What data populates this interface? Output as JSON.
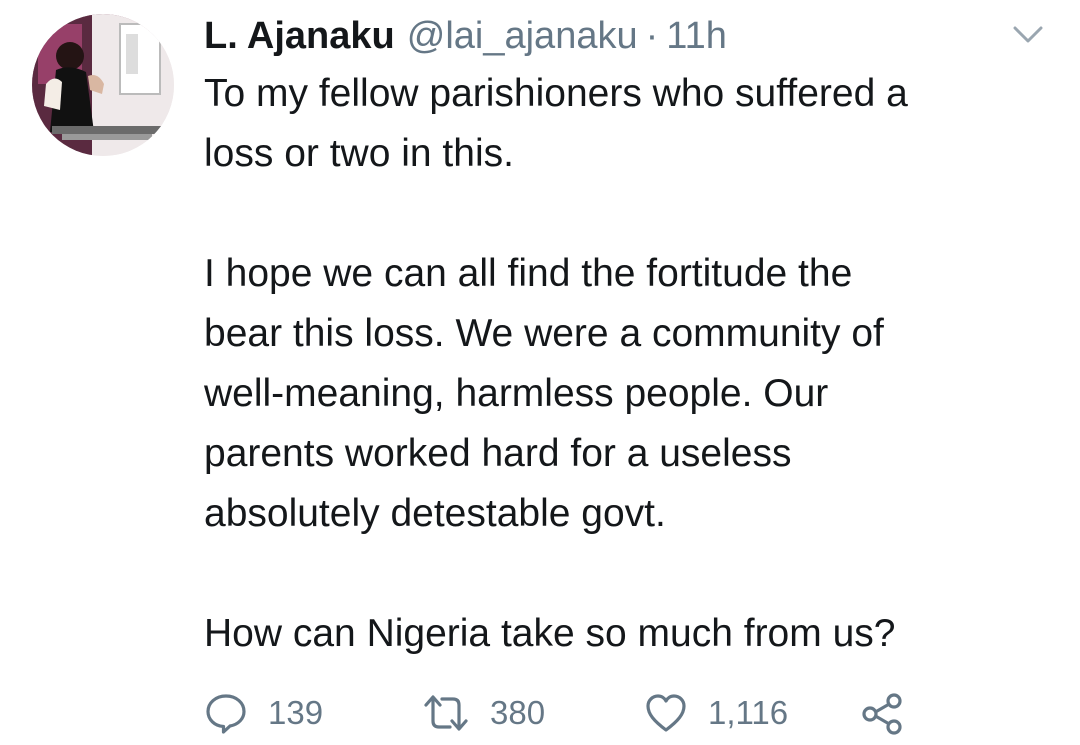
{
  "tweet": {
    "display_name": "L. Ajanaku",
    "handle": "@lai_ajanaku",
    "separator": "·",
    "time": "11h",
    "paragraphs": [
      [
        "To my fellow parishioners who suffered a",
        "loss or two in this."
      ],
      [
        "I hope we can all find the fortitude the",
        "bear this loss. We were a community of",
        "well-meaning, harmless people. Our",
        "parents worked hard for a useless",
        "absolutely detestable govt."
      ],
      [
        "How can Nigeria take so much from us?"
      ]
    ]
  },
  "actions": {
    "reply": {
      "icon": "reply-icon",
      "count": "139"
    },
    "retweet": {
      "icon": "retweet-icon",
      "count": "380"
    },
    "like": {
      "icon": "heart-icon",
      "count": "1,116"
    },
    "share": {
      "icon": "share-icon"
    }
  },
  "colors": {
    "text": "#14171a",
    "secondary": "#657786",
    "background": "#ffffff"
  }
}
